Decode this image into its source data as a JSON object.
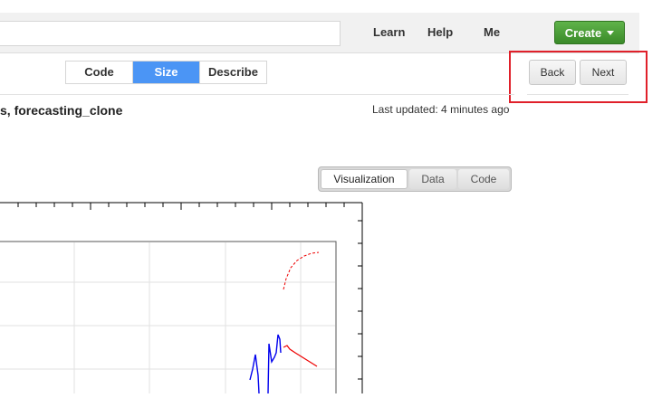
{
  "nav": {
    "search_value": "",
    "links": [
      "Learn",
      "Help",
      "Me"
    ],
    "create_label": "Create"
  },
  "mode_tabs": [
    "Code",
    "Size",
    "Describe"
  ],
  "mode_active": "Size",
  "pager": {
    "back_label": "Back",
    "next_label": "Next"
  },
  "page": {
    "title": "s, forecasting_clone",
    "last_updated": "Last updated: 4 minutes ago"
  },
  "view_tabs": [
    "Visualization",
    "Data",
    "Code"
  ],
  "view_active": "Visualization",
  "colors": {
    "accent": "#4b95f5",
    "create": "#45a033",
    "highlight": "#e0202a",
    "series_blue": "#0000ee",
    "series_red": "#ee0000"
  }
}
